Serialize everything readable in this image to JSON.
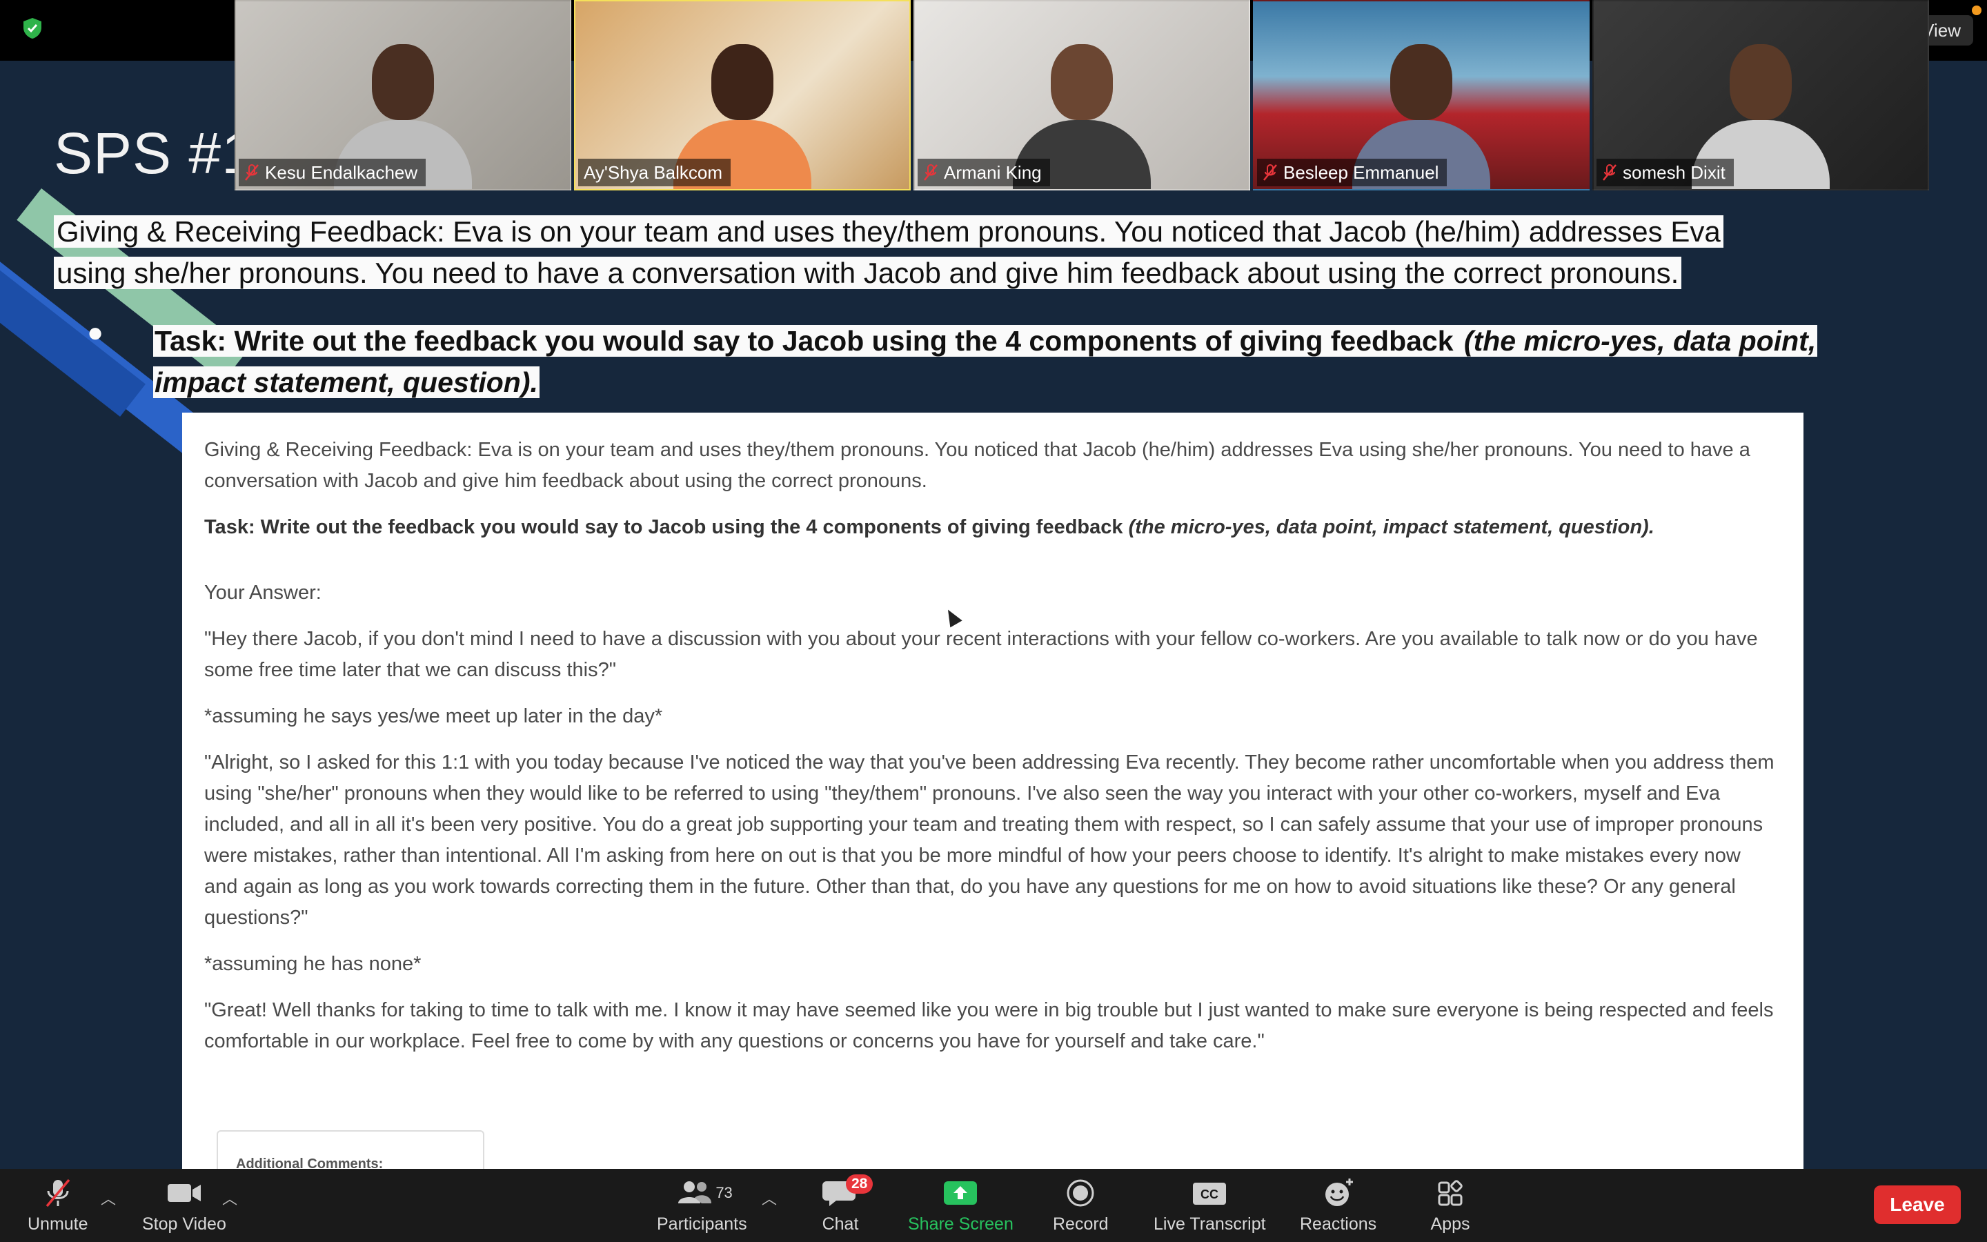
{
  "window": {
    "view_label": "View"
  },
  "participants": [
    {
      "name": "Kesu Endalkachew",
      "muted": true
    },
    {
      "name": "Ay'Shya Balkcom",
      "muted": false,
      "active_speaker": true
    },
    {
      "name": "Armani King",
      "muted": true
    },
    {
      "name": "Besleep Emmanuel",
      "muted": true
    },
    {
      "name": "somesh Dixit",
      "muted": true
    }
  ],
  "slide": {
    "title": "SPS #1",
    "scenario": "Giving & Receiving Feedback: Eva is on your team and uses they/them pronouns. You noticed that Jacob (he/him) addresses Eva using she/her pronouns. You need to have a conversation with Jacob and give him feedback about using the correct pronouns.",
    "bullet": "●",
    "task_main": "Task: Write out the feedback you would say to Jacob using the 4 components of giving feedback ",
    "task_italic": "(the micro-yes, data point, impact statement, question)."
  },
  "document": {
    "scenario": "Giving & Receiving Feedback: Eva is on your team and uses they/them pronouns. You noticed that Jacob (he/him) addresses Eva using she/her pronouns. You need to have a conversation with Jacob and give him feedback about using the correct pronouns.",
    "task_main": "Task: Write out the feedback you would say to Jacob using the 4 components of giving feedback ",
    "task_italic": "(the micro-yes, data point, impact statement, question).",
    "answer_label": "Your Answer:",
    "paragraphs": [
      "\"Hey there Jacob, if you don't mind I need to have a discussion with you about your recent interactions with your fellow co-workers. Are you available to talk now or do you have some free time later that we can discuss this?\"",
      "*assuming he says yes/we meet up later in the day*",
      "\"Alright, so I asked for this 1:1 with you today because I've noticed the way that you've been addressing Eva recently. They become rather uncomfortable when you address them using \"she/her\" pronouns when they would like to be referred to using \"they/them\" pronouns. I've also seen the way you interact with your other co-workers, myself and Eva included, and all in all it's been very positive. You do a great job supporting your team and treating them with respect, so I can safely assume that your use of improper pronouns were mistakes, rather than intentional. All I'm asking from here on out is that you be more mindful of how your peers choose to identify. It's alright to make mistakes every now and again as long as you work towards correcting them in the future. Other than that, do you have any questions for me on how to avoid situations like these? Or any general questions?\"",
      "*assuming he has none*",
      "\"Great! Well thanks for taking to time to talk with me. I know it may have seemed like you were in big trouble but I just wanted to make sure everyone is being respected and feels comfortable in our workplace. Feel free to come by with any questions or concerns you have for yourself and take care.\""
    ],
    "comments_label": "Additional Comments:"
  },
  "toolbar": {
    "unmute": "Unmute",
    "stop_video": "Stop Video",
    "participants": "Participants",
    "participants_count": "73",
    "chat": "Chat",
    "chat_badge": "28",
    "share_screen": "Share Screen",
    "record": "Record",
    "live_transcript": "Live Transcript",
    "reactions": "Reactions",
    "apps": "Apps",
    "leave": "Leave"
  },
  "colors": {
    "leave": "#e02e2e",
    "share": "#27c25e",
    "active_border": "#f5e05a",
    "badge": "#e8353b"
  }
}
